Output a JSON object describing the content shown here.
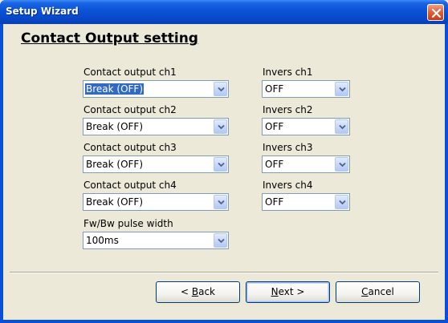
{
  "window": {
    "title": "Setup Wizard"
  },
  "page": {
    "heading": "Contact Output setting"
  },
  "fields": {
    "ch1": {
      "label": "Contact output ch1",
      "value": "Break (OFF)",
      "invers_label": "Invers ch1",
      "invers_value": "OFF"
    },
    "ch2": {
      "label": "Contact output ch2",
      "value": "Break (OFF)",
      "invers_label": "Invers ch2",
      "invers_value": "OFF"
    },
    "ch3": {
      "label": "Contact output ch3",
      "value": "Break (OFF)",
      "invers_label": "Invers ch3",
      "invers_value": "OFF"
    },
    "ch4": {
      "label": "Contact output ch4",
      "value": "Break (OFF)",
      "invers_label": "Invers ch4",
      "invers_value": "OFF"
    },
    "pulse": {
      "label": "Fw/Bw pulse width",
      "value": "100ms"
    }
  },
  "buttons": {
    "back": {
      "prefix": "< ",
      "mnemonic": "B",
      "rest": "ack"
    },
    "next": {
      "mnemonic": "N",
      "rest": "ext >"
    },
    "cancel": {
      "mnemonic": "C",
      "rest": "ancel"
    }
  },
  "colors": {
    "titlebar": "#0a52d6",
    "selection": "#316ac5",
    "dialog_bg": "#ece9d8"
  },
  "icons": {
    "close": "close-icon",
    "dropdown": "chevron-down-icon"
  }
}
